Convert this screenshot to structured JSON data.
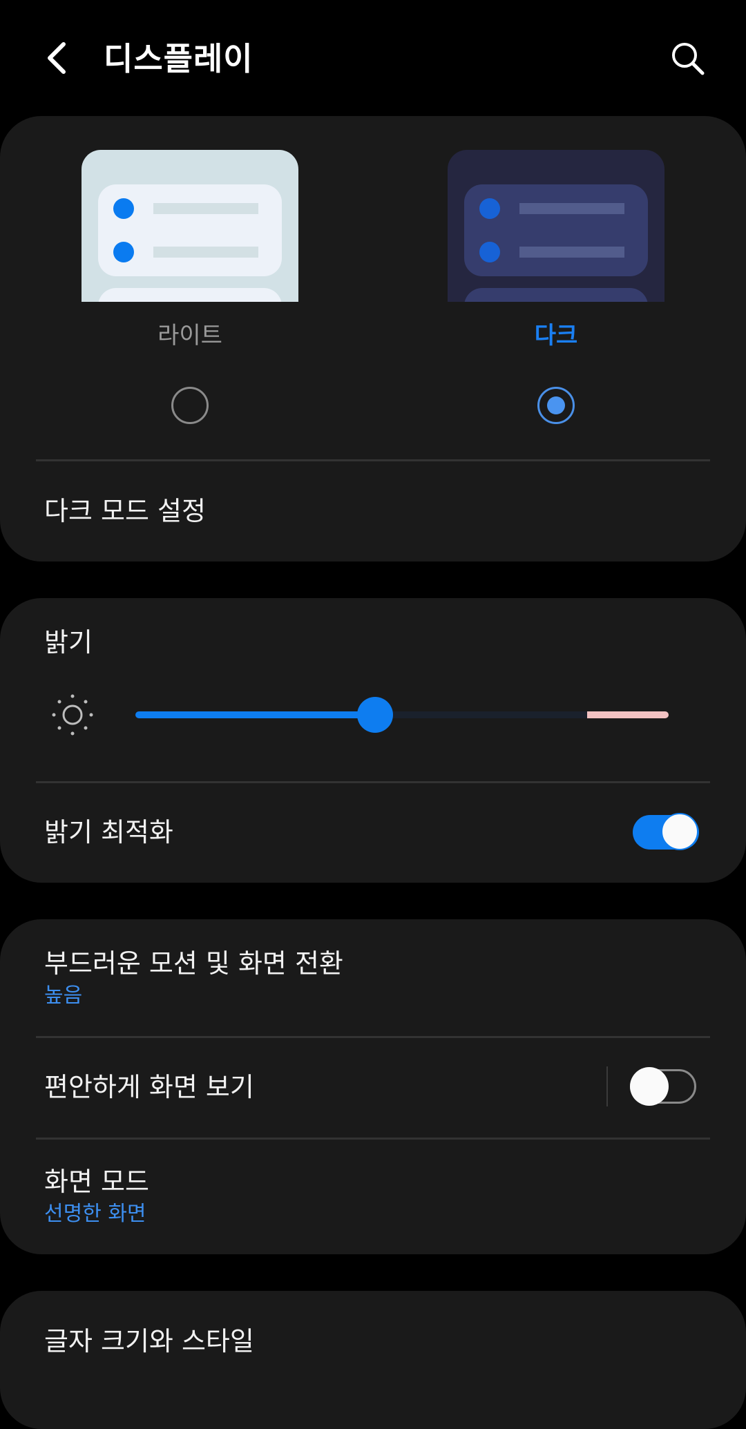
{
  "header": {
    "title": "디스플레이",
    "back_icon": "chevron-left-icon",
    "search_icon": "search-icon"
  },
  "theme": {
    "options": [
      {
        "label": "라이트",
        "selected": false
      },
      {
        "label": "다크",
        "selected": true
      }
    ],
    "dark_mode_settings_label": "다크 모드 설정"
  },
  "brightness": {
    "title": "밝기",
    "icon": "sun-icon",
    "level_percent": 45,
    "adaptive_label": "밝기 최적화",
    "adaptive_on": true
  },
  "motion": {
    "label": "부드러운 모션 및 화면 전환",
    "value": "높음"
  },
  "eye_comfort": {
    "label": "편안하게 화면 보기",
    "on": false
  },
  "screen_mode": {
    "label": "화면 모드",
    "value": "선명한 화면"
  },
  "font": {
    "label": "글자 크기와 스타일"
  },
  "colors": {
    "accent": "#0e7df0",
    "accent_text": "#3d8ff0",
    "card_bg": "#1a1a1a",
    "page_bg": "#000000"
  }
}
